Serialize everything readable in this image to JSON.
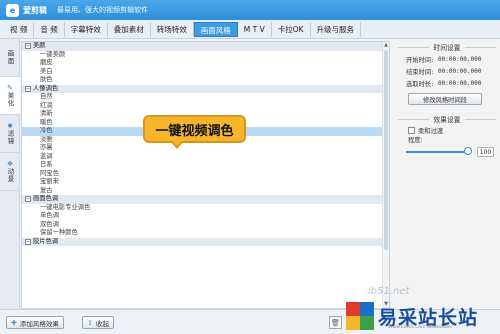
{
  "titlebar": {
    "app_logo": "e",
    "app_name": "爱剪辑",
    "slogan": "最易用、强大的视频剪辑软件"
  },
  "menu": [
    {
      "label": "视  频",
      "active": false
    },
    {
      "label": "音  频",
      "active": false
    },
    {
      "label": "字幕特效",
      "active": false
    },
    {
      "label": "叠加素材",
      "active": false
    },
    {
      "label": "转场特效",
      "active": false
    },
    {
      "label": "画面风格",
      "active": true
    },
    {
      "label": "M T V",
      "active": false
    },
    {
      "label": "卡拉OK",
      "active": false
    },
    {
      "label": "升级与服务",
      "active": false
    }
  ],
  "sidetabs": [
    {
      "label": "画面",
      "icon": "picture-icon",
      "glyph": "",
      "active": false
    },
    {
      "label": "美化",
      "icon": "magic-wand-icon",
      "glyph": "✎",
      "active": true
    },
    {
      "label": "滤镜",
      "icon": "filter-icon",
      "glyph": "✸",
      "active": false
    },
    {
      "label": "动景",
      "icon": "motion-icon",
      "glyph": "❖",
      "active": false
    }
  ],
  "list": [
    {
      "type": "group",
      "label": "美颜",
      "toggle": "−"
    },
    {
      "type": "item",
      "label": "一键美颜"
    },
    {
      "type": "item",
      "label": "磨皮"
    },
    {
      "type": "item",
      "label": "美白"
    },
    {
      "type": "item",
      "label": "肤色"
    },
    {
      "type": "group",
      "label": "人像调色",
      "toggle": "−"
    },
    {
      "type": "item",
      "label": "自然"
    },
    {
      "type": "item",
      "label": "红润"
    },
    {
      "type": "item",
      "label": "清新"
    },
    {
      "type": "item",
      "label": "暖色"
    },
    {
      "type": "item",
      "label": "冷色",
      "selected": true
    },
    {
      "type": "item",
      "label": "淡雅"
    },
    {
      "type": "item",
      "label": "亦暑"
    },
    {
      "type": "item",
      "label": "蓝调"
    },
    {
      "type": "item",
      "label": "日系"
    },
    {
      "type": "item",
      "label": "阿宝色"
    },
    {
      "type": "item",
      "label": "宝丽来"
    },
    {
      "type": "item",
      "label": "复古"
    },
    {
      "type": "group",
      "label": "画面色调",
      "toggle": "−"
    },
    {
      "type": "item",
      "label": "一键电影专业调色"
    },
    {
      "type": "item",
      "label": "单色调"
    },
    {
      "type": "item",
      "label": "双色调"
    },
    {
      "type": "item",
      "label": "保留一种颜色"
    },
    {
      "type": "group",
      "label": "胶片色调",
      "toggle": "−"
    }
  ],
  "callout": {
    "text": "一键视频调色"
  },
  "right": {
    "time_title": "时间设置",
    "start_label": "开始时间:",
    "start_value": "00:00:00.000",
    "end_label": "结束时间:",
    "end_value": "00:00:00.000",
    "duration_label": "选取时长:",
    "duration_value": "00:00:00.000",
    "adjust_button": "修改风格时间段",
    "effect_title": "效果设置",
    "soft_label": "柔和过渡",
    "degree_label": "程度:",
    "degree_value": "100",
    "degree_fraction": 1.0
  },
  "bottom": {
    "add_label": "添加风格效果",
    "collapse_label": "收起",
    "trash_glyph": "🗑"
  },
  "watermark": {
    "url": "ib51.net",
    "name": "易采站长站",
    "sub": "Www.Easck.Com Webmaster"
  }
}
